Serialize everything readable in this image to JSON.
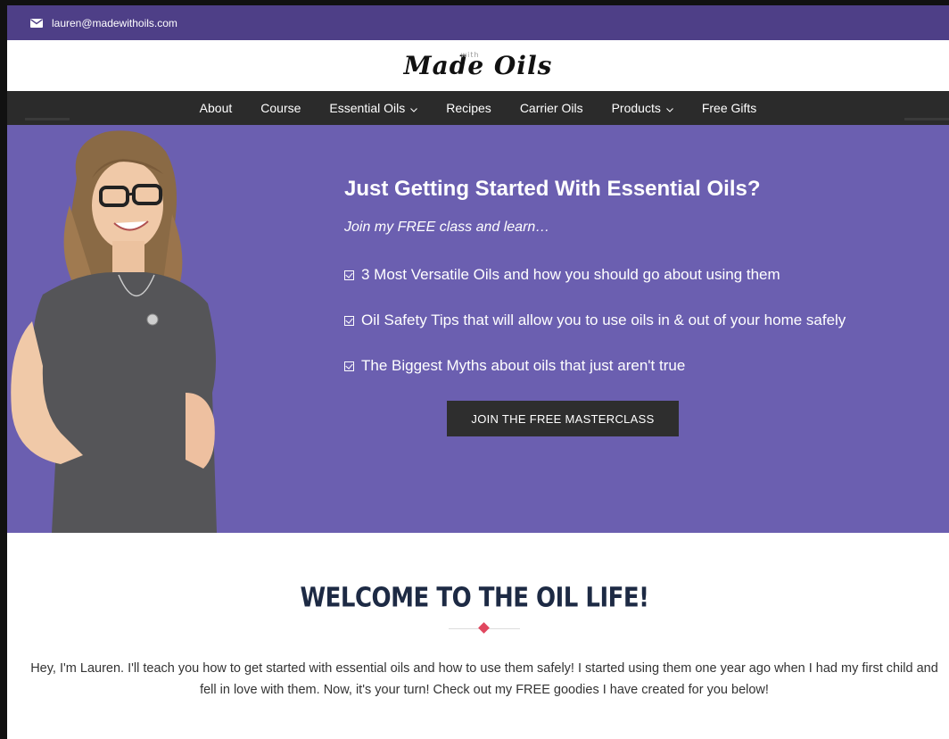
{
  "topbar": {
    "email": "lauren@madewithoils.com",
    "icon": "mail-icon"
  },
  "logo": {
    "text": "Made Oils",
    "small": "with"
  },
  "nav": {
    "items": [
      {
        "label": "About",
        "dropdown": false
      },
      {
        "label": "Course",
        "dropdown": false
      },
      {
        "label": "Essential Oils",
        "dropdown": true
      },
      {
        "label": "Recipes",
        "dropdown": false
      },
      {
        "label": "Carrier Oils",
        "dropdown": false
      },
      {
        "label": "Products",
        "dropdown": true
      },
      {
        "label": "Free Gifts",
        "dropdown": false
      }
    ]
  },
  "hero": {
    "title": "Just Getting Started With Essential Oils?",
    "subtitle": "Join my FREE class and learn…",
    "benefits": [
      "3 Most Versatile Oils and how you should go about using them",
      "Oil Safety Tips that will allow you to use oils in & out of your home safely",
      "The Biggest Myths about oils that just aren't true"
    ],
    "cta": "JOIN THE FREE MASTERCLASS"
  },
  "welcome": {
    "title": "WELCOME TO THE OIL LIFE!",
    "text": "Hey, I'm Lauren. I'll teach you how to get started with essential oils and how to use them safely! I started using them one year ago when I had my first child and fell in love with them. Now, it's your turn! Check out my FREE goodies I have created for you below!"
  },
  "colors": {
    "topbar": "#4e3f87",
    "hero": "#6b5fb0",
    "nav": "#2b2b2b",
    "accent": "#e0475f",
    "heading": "#1d2a44"
  }
}
